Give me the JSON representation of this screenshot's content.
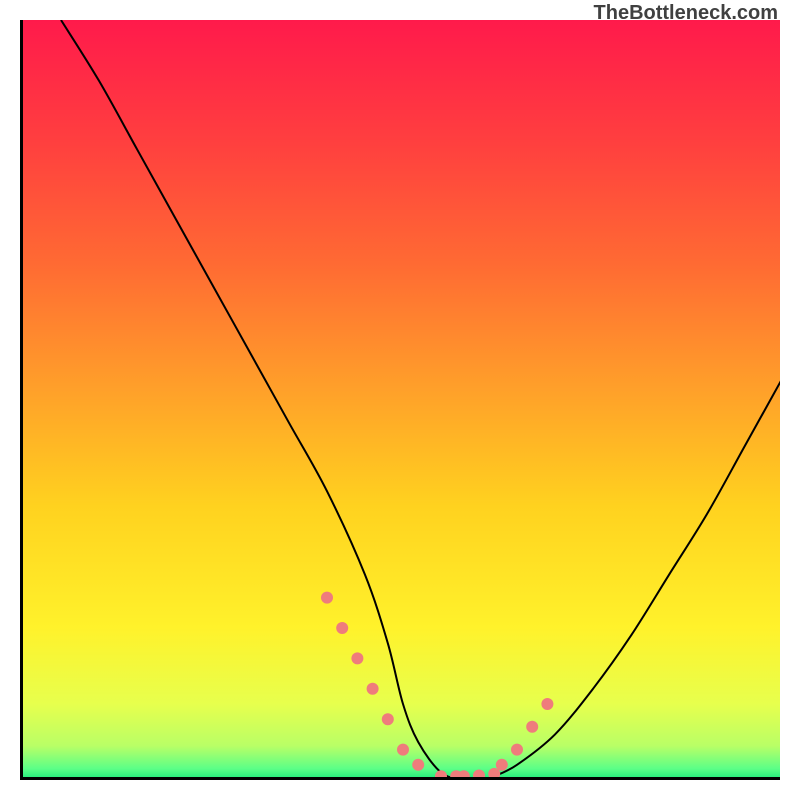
{
  "watermark": "TheBottleneck.com",
  "chart_data": {
    "type": "line",
    "title": "",
    "xlabel": "",
    "ylabel": "",
    "xlim": [
      0,
      100
    ],
    "ylim": [
      0,
      100
    ],
    "grid": false,
    "legend": false,
    "gradient_stops": [
      {
        "offset": 0.0,
        "color": "#ff1a4b"
      },
      {
        "offset": 0.16,
        "color": "#ff3f3f"
      },
      {
        "offset": 0.32,
        "color": "#ff6a33"
      },
      {
        "offset": 0.48,
        "color": "#ff9e2a"
      },
      {
        "offset": 0.64,
        "color": "#ffd21f"
      },
      {
        "offset": 0.8,
        "color": "#fff22b"
      },
      {
        "offset": 0.9,
        "color": "#e7ff4d"
      },
      {
        "offset": 0.955,
        "color": "#b9ff66"
      },
      {
        "offset": 0.985,
        "color": "#5cff87"
      },
      {
        "offset": 1.0,
        "color": "#19e87a"
      }
    ],
    "series": [
      {
        "name": "bottleneck-curve",
        "color": "#000000",
        "x": [
          5,
          10,
          15,
          20,
          25,
          30,
          35,
          40,
          45,
          48,
          50,
          52,
          55,
          58,
          60,
          62,
          65,
          70,
          75,
          80,
          85,
          90,
          95,
          100
        ],
        "values": [
          100,
          92,
          83,
          74,
          65,
          56,
          47,
          38,
          27,
          18,
          10,
          5,
          1,
          0,
          0,
          0.5,
          2,
          6,
          12,
          19,
          27,
          35,
          44,
          53
        ]
      }
    ],
    "markers": {
      "name": "highlight-points",
      "color": "#ef7c7c",
      "radius": 6,
      "x": [
        40,
        42,
        44,
        46,
        48,
        50,
        52,
        55,
        57,
        58,
        60,
        62,
        63,
        65,
        67,
        69
      ],
      "values": [
        24,
        20,
        16,
        12,
        8,
        4,
        2,
        0.5,
        0.5,
        0.5,
        0.6,
        0.8,
        2,
        4,
        7,
        10
      ]
    }
  }
}
